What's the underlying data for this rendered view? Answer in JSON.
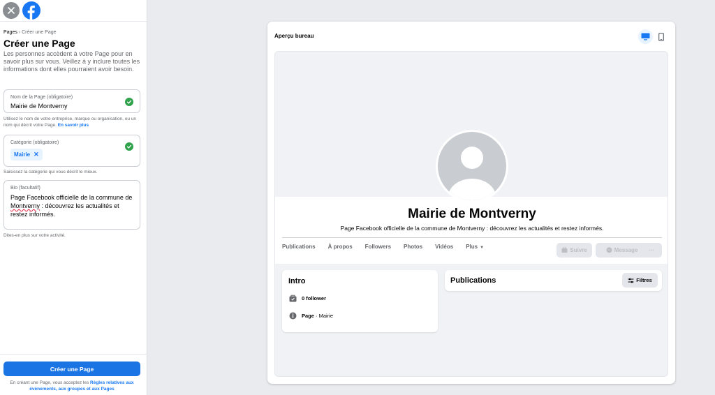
{
  "left": {
    "breadcrumb": {
      "root": "Pages",
      "sep": "›",
      "current": "Créer une Page"
    },
    "title": "Créer une Page",
    "intro": "Les personnes accèdent à votre Page pour en savoir plus sur vous. Veillez à y inclure toutes les informations dont elles pourraient avoir besoin.",
    "name_field": {
      "label": "Nom de la Page (obligatoire)",
      "value": "Mairie de Montverny"
    },
    "name_help": "Utilisez le nom de votre entreprise, marque ou organisation, ou un nom qui décrit votre Page.",
    "name_help_link": "En savoir plus",
    "category_field": {
      "label": "Catégorie (obligatoire)",
      "chip": "Mairie",
      "chip_remove": "✕"
    },
    "category_help": "Saisissez la catégorie qui vous décrit le mieux.",
    "bio_field": {
      "label": "Bio (facultatif)",
      "line1": "Page Facebook officielle de la commune de",
      "squiggle": "Montverny",
      "line2": " : découvrez les actualités et restez informés."
    },
    "bio_help": "Dites-en plus sur votre activité.",
    "create_button": "Créer une Page",
    "terms_prefix": "En créant une Page, vous acceptez les",
    "terms_link": "Règles relatives aux évènements, aux groupes et aux Pages"
  },
  "preview": {
    "title": "Aperçu bureau",
    "page_name": "Mairie de Montverny",
    "page_bio": "Page Facebook officielle de la commune de Montverny : découvrez les actualités et restez informés.",
    "tabs": [
      "Publications",
      "À propos",
      "Followers",
      "Photos",
      "Vidéos"
    ],
    "more_tab": "Plus",
    "actions": {
      "follow": "Suivre",
      "message": "Message",
      "more": "···"
    },
    "intro": {
      "title": "Intro",
      "followers": "0 follower",
      "page_label": "Page",
      "page_category": " · Mairie"
    },
    "publications": {
      "title": "Publications",
      "filter": "Filtres"
    }
  },
  "colors": {
    "brand_blue": "#1877f2",
    "check_green": "#31a24c",
    "gray_bg": "#f0f2f5"
  },
  "icons": [
    "close-icon",
    "facebook-logo-icon",
    "check-circle-icon",
    "desktop-icon",
    "mobile-icon",
    "default-avatar-icon",
    "follow-icon",
    "messenger-icon",
    "followers-icon",
    "info-icon",
    "filter-icon"
  ]
}
